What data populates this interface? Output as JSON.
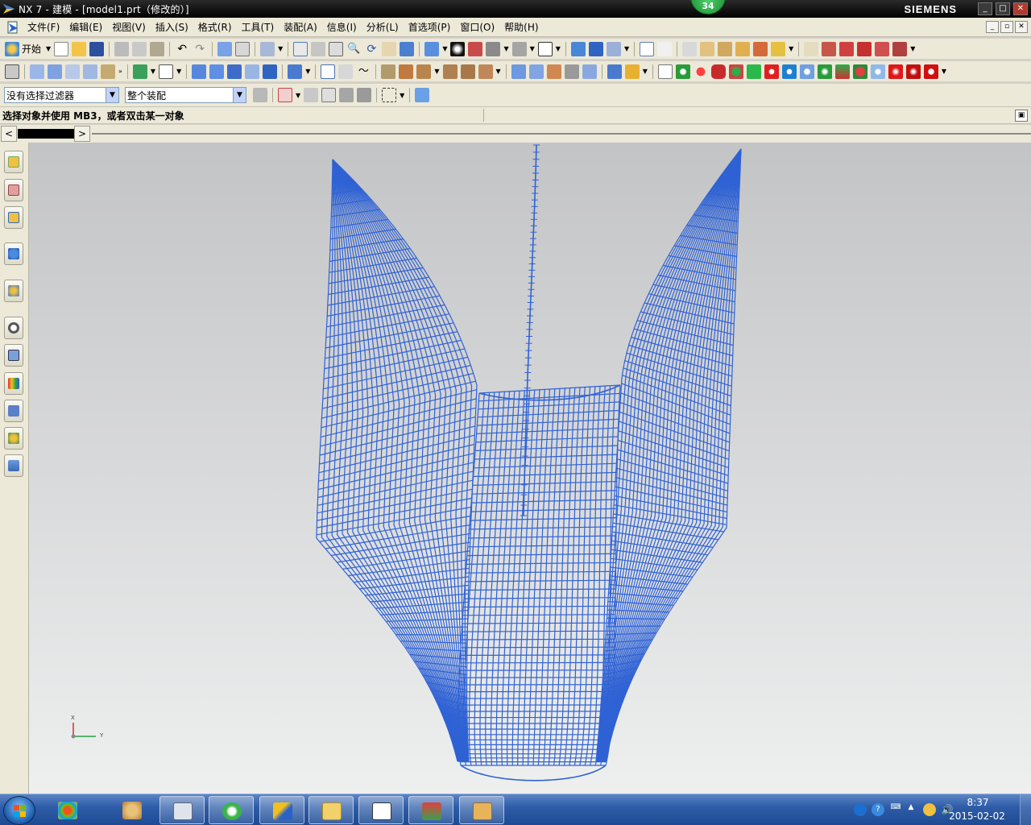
{
  "window": {
    "title": "NX 7 - 建模 - [model1.prt（修改的）]",
    "brand": "SIEMENS",
    "badge": "34",
    "controls": [
      "_",
      "□",
      "✕"
    ]
  },
  "menubar": {
    "items": [
      "文件(F)",
      "编辑(E)",
      "视图(V)",
      "插入(S)",
      "格式(R)",
      "工具(T)",
      "装配(A)",
      "信息(I)",
      "分析(L)",
      "首选项(P)",
      "窗口(O)",
      "帮助(H)"
    ]
  },
  "toolbar1": {
    "start_label": "开始"
  },
  "selection": {
    "type_filter": "没有选择过滤器",
    "scope": "整个装配"
  },
  "cue": {
    "text": "选择对象并使用 MB3，或者双击某一对象"
  },
  "tabstrip": {
    "prev": "<",
    "next": ">"
  },
  "triad": {
    "x_label": "X",
    "y_label": "Y"
  },
  "taskbar": {
    "time": "8:37",
    "date": "2015-02-02"
  },
  "colors": {
    "mesh": "#2f62d4",
    "viewport_top": "#c3c4c6",
    "viewport_bottom": "#eeefef",
    "taskbar": "#2f5da8"
  },
  "icons": {
    "app": "nx-logo-icon",
    "resource_bar": [
      "assembly-navigator-icon",
      "constraint-navigator-icon",
      "part-navigator-icon",
      "reuse-library-icon",
      "web-browser-icon",
      "history-icon",
      "system-materials-icon",
      "visualization-icon",
      "process-studio-icon",
      "roles-icon",
      "system-scenes-icon"
    ],
    "taskbar": [
      "explorer-icon",
      "paint-icon",
      "calculator-icon",
      "browser-icon",
      "nx-icon",
      "folder-icon",
      "files-icon",
      "game-icon",
      "users-icon"
    ]
  }
}
